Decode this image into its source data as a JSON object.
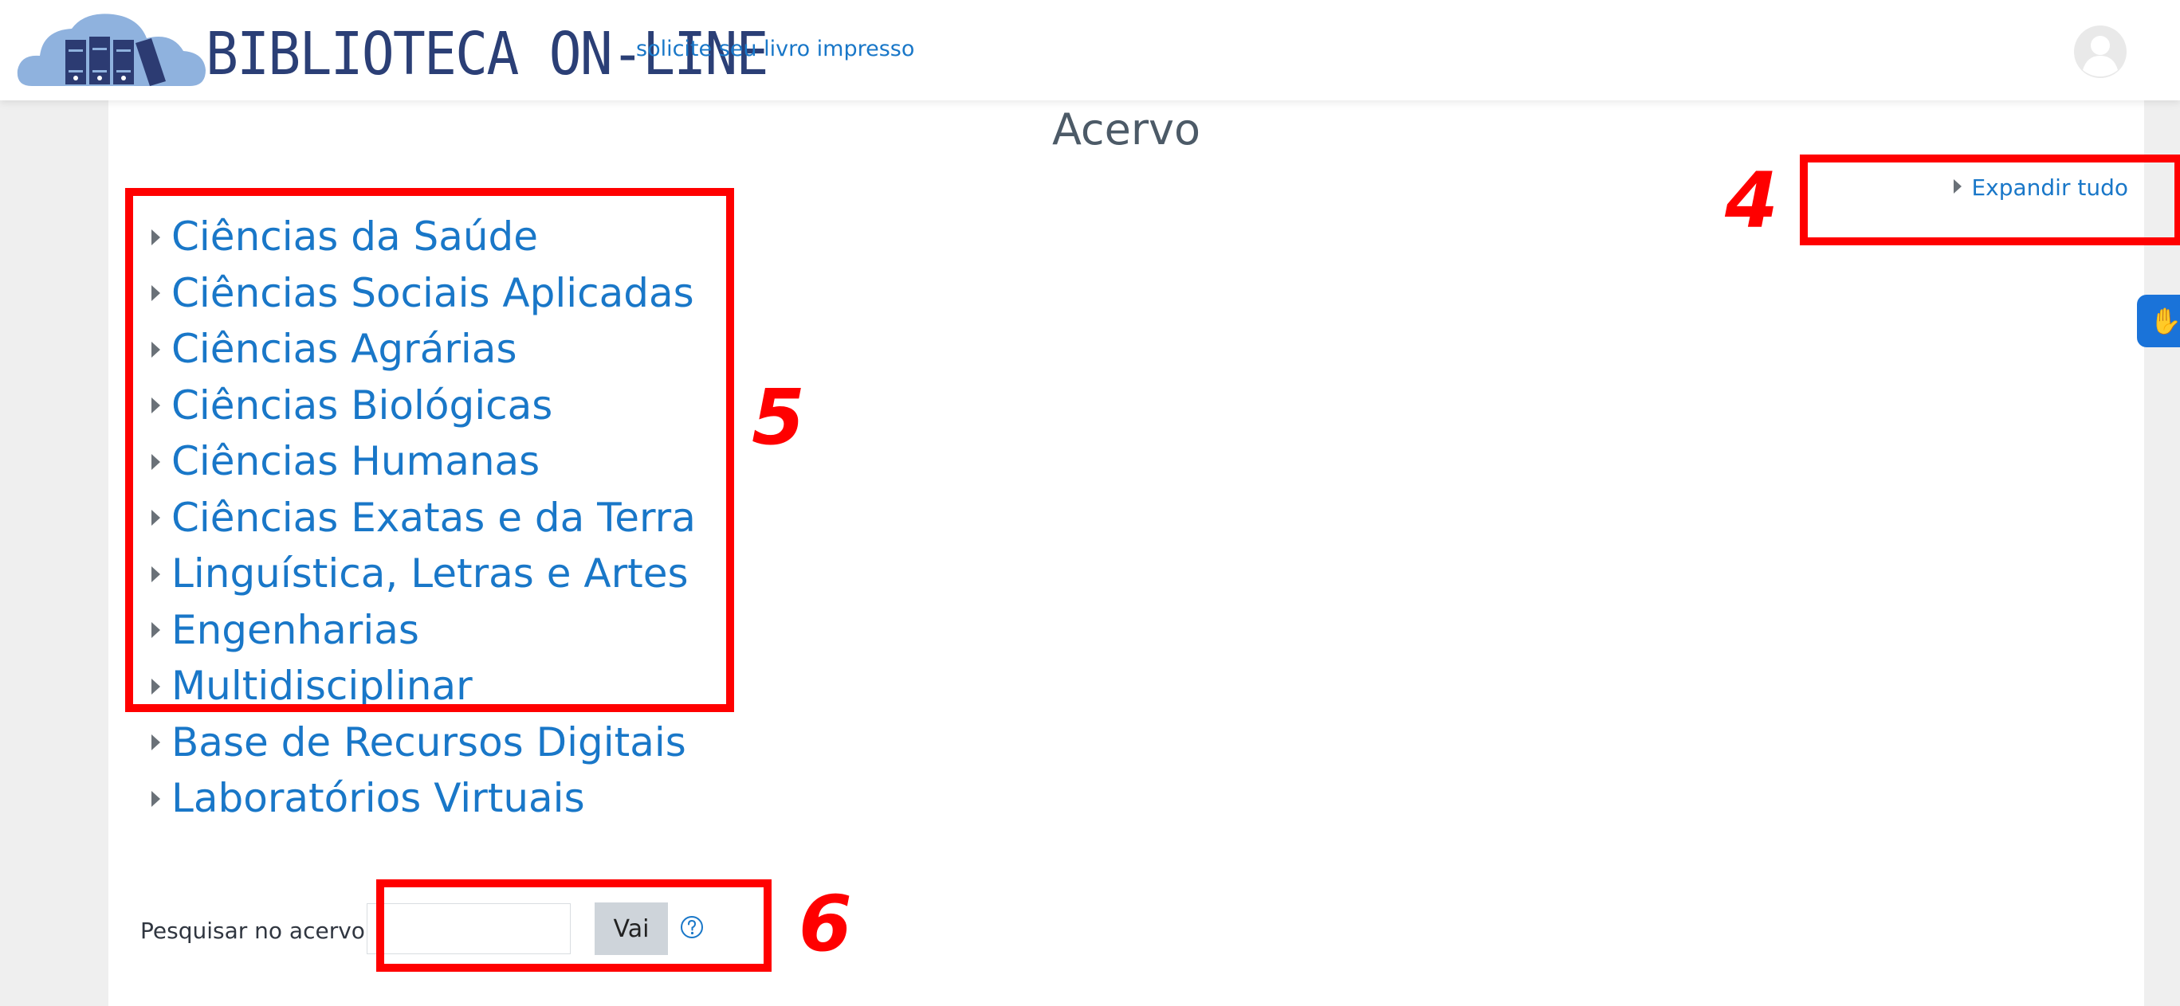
{
  "header": {
    "brand": "BIBLIOTECA ON-LINE",
    "tagline": "solicite seu livro impresso"
  },
  "main": {
    "title": "Acervo",
    "expand_all": "Expandir tudo",
    "categories": [
      "Ciências da Saúde",
      "Ciências Sociais Aplicadas",
      "Ciências Agrárias",
      "Ciências Biológicas",
      "Ciências Humanas",
      "Ciências Exatas e da Terra",
      "Linguística, Letras e Artes",
      "Engenharias",
      "Multidisciplinar",
      "Base de Recursos Digitais",
      "Laboratórios Virtuais"
    ]
  },
  "search": {
    "label": "Pesquisar no acervo",
    "value": "",
    "button": "Vai"
  },
  "annotations": [
    "4",
    "5",
    "6"
  ],
  "colors": {
    "link": "#1977c8",
    "brand": "#2b3f76",
    "annotation": "#ff0000",
    "accessibility": "#1a73d9"
  },
  "icons": [
    "logo-cloud-books-icon",
    "avatar-icon",
    "help-icon",
    "caret-right-icon",
    "hand-sign-language-icon"
  ]
}
